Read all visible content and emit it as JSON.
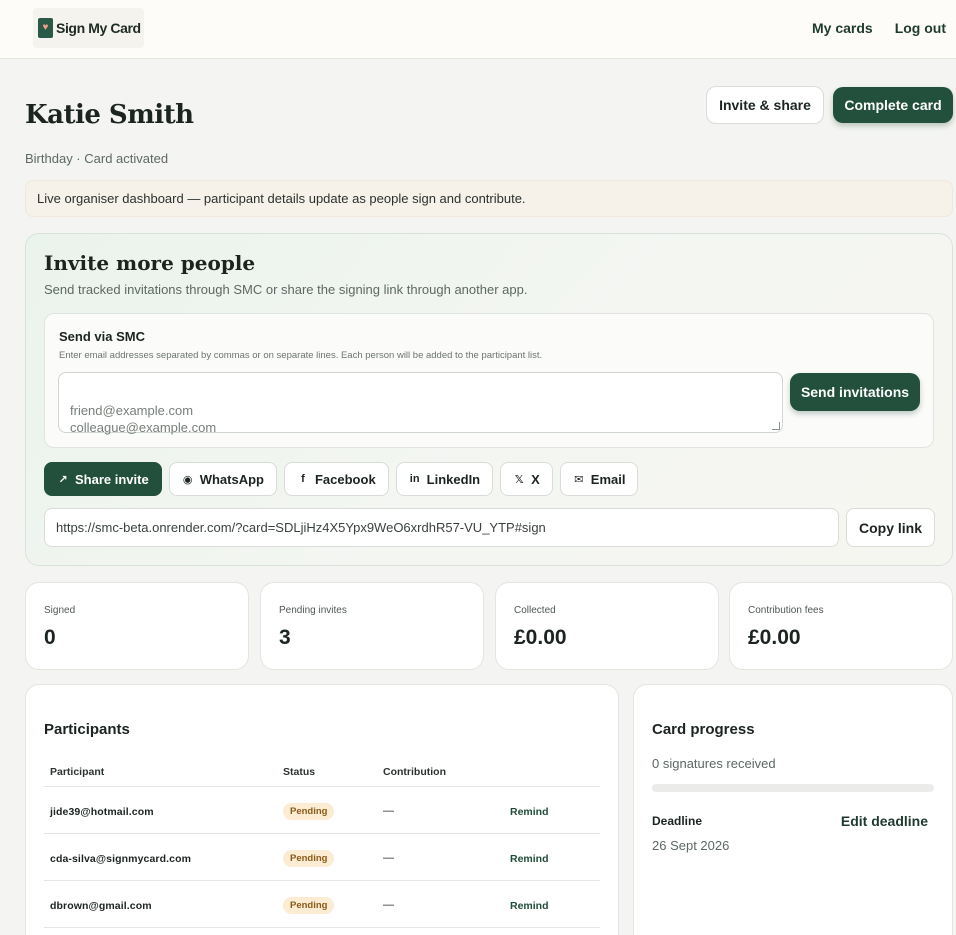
{
  "brand": {
    "name": "Sign My Card",
    "logo_icon": "card-heart-icon"
  },
  "nav": {
    "my_cards": "My cards",
    "log_out": "Log out"
  },
  "card": {
    "recipient": "Katie Smith",
    "meta": "Birthday · Card activated",
    "invite_share_label": "Invite & share",
    "complete_label": "Complete card"
  },
  "banner": "Live organiser dashboard — participant details update as people sign and contribute.",
  "invite": {
    "title": "Invite more people",
    "description": "Send tracked invitations through SMC or share the signing link through another app.",
    "smc": {
      "title": "Send via SMC",
      "help": "Enter email addresses separated by commas or on separate lines. Each person will be added to the participant list.",
      "placeholder": "friend@example.com\ncolleague@example.com",
      "send_label": "Send invitations"
    },
    "share_buttons": [
      {
        "label": "Share invite",
        "icon": "share-arrow-icon"
      },
      {
        "label": "WhatsApp",
        "icon": "whatsapp-icon"
      },
      {
        "label": "Facebook",
        "icon": "facebook-icon"
      },
      {
        "label": "LinkedIn",
        "icon": "linkedin-icon"
      },
      {
        "label": "X",
        "icon": "x-icon"
      },
      {
        "label": "Email",
        "icon": "email-icon"
      }
    ],
    "link": "https://smc-beta.onrender.com/?card=SDLjiHz4X5Ypx9WeO6xrdhR57-VU_YTP#sign",
    "copy_label": "Copy link"
  },
  "stats": [
    {
      "label": "Signed",
      "value": "0"
    },
    {
      "label": "Pending invites",
      "value": "3"
    },
    {
      "label": "Collected",
      "value": "£0.00"
    },
    {
      "label": "Contribution fees",
      "value": "£0.00"
    }
  ],
  "participants": {
    "title": "Participants",
    "columns": [
      "Participant",
      "Status",
      "Contribution"
    ],
    "rows": [
      {
        "email": "jide39@hotmail.com",
        "status": "Pending",
        "contribution": "—",
        "action": "Remind"
      },
      {
        "email": "cda-silva@signmycard.com",
        "status": "Pending",
        "contribution": "—",
        "action": "Remind"
      },
      {
        "email": "dbrown@gmail.com",
        "status": "Pending",
        "contribution": "—",
        "action": "Remind"
      }
    ]
  },
  "progress": {
    "title": "Card progress",
    "signatures_text": "0 signatures received",
    "fraction": 0,
    "deadline_label": "Deadline",
    "edit_deadline_label": "Edit deadline",
    "deadline_value": "26 Sept 2026"
  },
  "colors": {
    "brand_dark": "#234f3d",
    "pending_badge_bg": "#fbecd3",
    "pending_badge_text": "#8a5b18"
  }
}
